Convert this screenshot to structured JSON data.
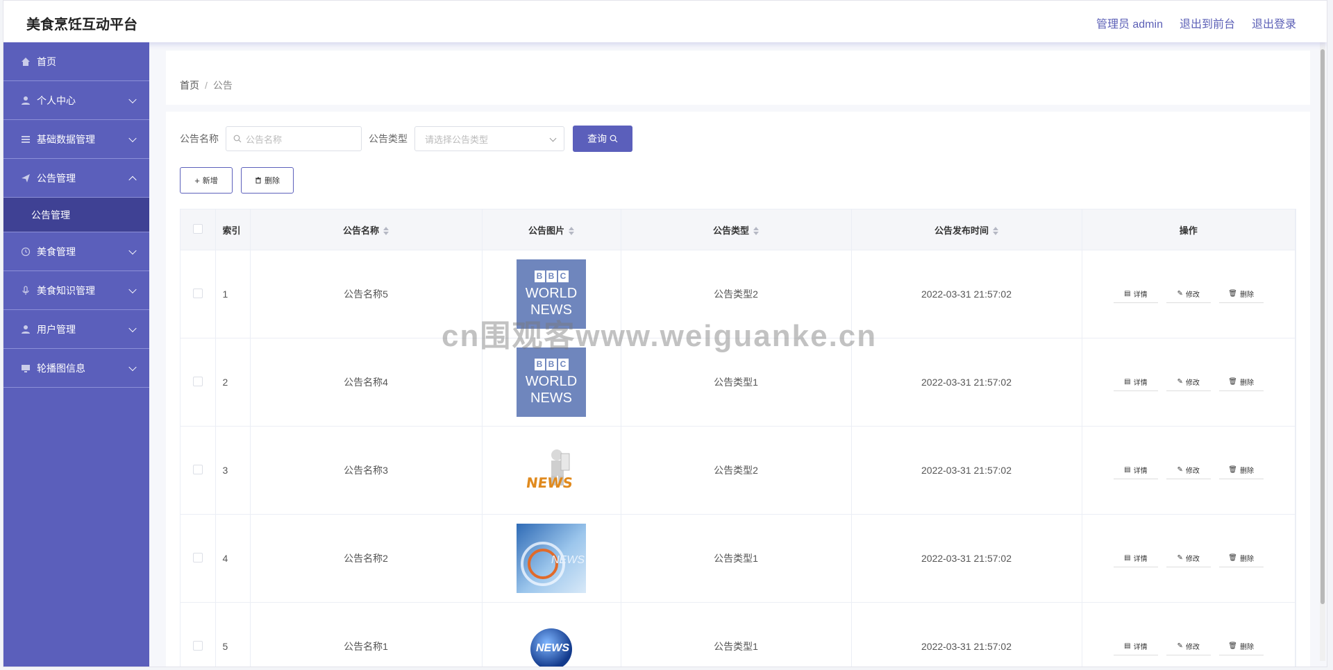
{
  "app": {
    "title": "美食烹饪互动平台",
    "admin_label": "管理员 admin",
    "front_label": "退出到前台",
    "logout_label": "退出登录"
  },
  "sidebar": {
    "items": [
      {
        "label": "首页",
        "icon": "home-icon"
      },
      {
        "label": "个人中心",
        "icon": "user-icon"
      },
      {
        "label": "基础数据管理",
        "icon": "list-icon"
      },
      {
        "label": "公告管理",
        "icon": "send-icon",
        "expanded": true
      },
      {
        "label": "美食管理",
        "icon": "clock-icon"
      },
      {
        "label": "美食知识管理",
        "icon": "mic-icon"
      },
      {
        "label": "用户管理",
        "icon": "user-icon"
      },
      {
        "label": "轮播图信息",
        "icon": "monitor-icon"
      }
    ],
    "submenu_label": "公告管理"
  },
  "breadcrumb": {
    "home": "首页",
    "sep": "/",
    "current": "公告"
  },
  "search": {
    "name_label": "公告名称",
    "name_placeholder": "公告名称",
    "type_label": "公告类型",
    "type_placeholder": "请选择公告类型",
    "query_label": "查询"
  },
  "actions": {
    "add_label": "新增",
    "delete_label": "删除"
  },
  "table": {
    "headers": {
      "index": "索引",
      "name": "公告名称",
      "image": "公告图片",
      "type": "公告类型",
      "time": "公告发布时间",
      "ops": "操作"
    },
    "op_labels": {
      "detail": "详情",
      "edit": "修改",
      "delete": "删除"
    },
    "rows": [
      {
        "index": "1",
        "name": "公告名称5",
        "type": "公告类型2",
        "time": "2022-03-31 21:57:02"
      },
      {
        "index": "2",
        "name": "公告名称4",
        "type": "公告类型1",
        "time": "2022-03-31 21:57:02"
      },
      {
        "index": "3",
        "name": "公告名称3",
        "type": "公告类型2",
        "time": "2022-03-31 21:57:02"
      },
      {
        "index": "4",
        "name": "公告名称2",
        "type": "公告类型1",
        "time": "2022-03-31 21:57:02"
      },
      {
        "index": "5",
        "name": "公告名称1",
        "type": "公告类型1",
        "time": "2022-03-31 21:57:02"
      }
    ],
    "image_text": {
      "bbc": "BBC",
      "world": "WORLD",
      "news": "NEWS",
      "news_lower": "NEWS"
    }
  },
  "watermark": "cn围观客www.weiguanke.cn",
  "colors": {
    "accent": "#5b5fbb",
    "submenu": "#3f4194"
  }
}
